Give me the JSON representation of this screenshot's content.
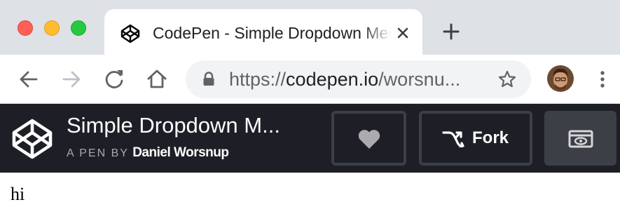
{
  "window": {
    "controls": [
      "close",
      "minimize",
      "maximize"
    ]
  },
  "tab": {
    "title": "CodePen - Simple Dropdown Menu",
    "favicon": "codepen-logo-icon"
  },
  "toolbar": {
    "url_scheme": "https://",
    "url_host": "codepen.io",
    "url_path": "/worsnu..."
  },
  "pen": {
    "title": "Simple Dropdown M...",
    "by_label": "A PEN BY",
    "author": "Daniel Worsnup",
    "fork_label": "Fork"
  },
  "page": {
    "body_text": "hi"
  },
  "colors": {
    "header_bg": "#1e1f26",
    "button_border": "#3c3f46",
    "tabstrip_bg": "#dee1e6"
  }
}
